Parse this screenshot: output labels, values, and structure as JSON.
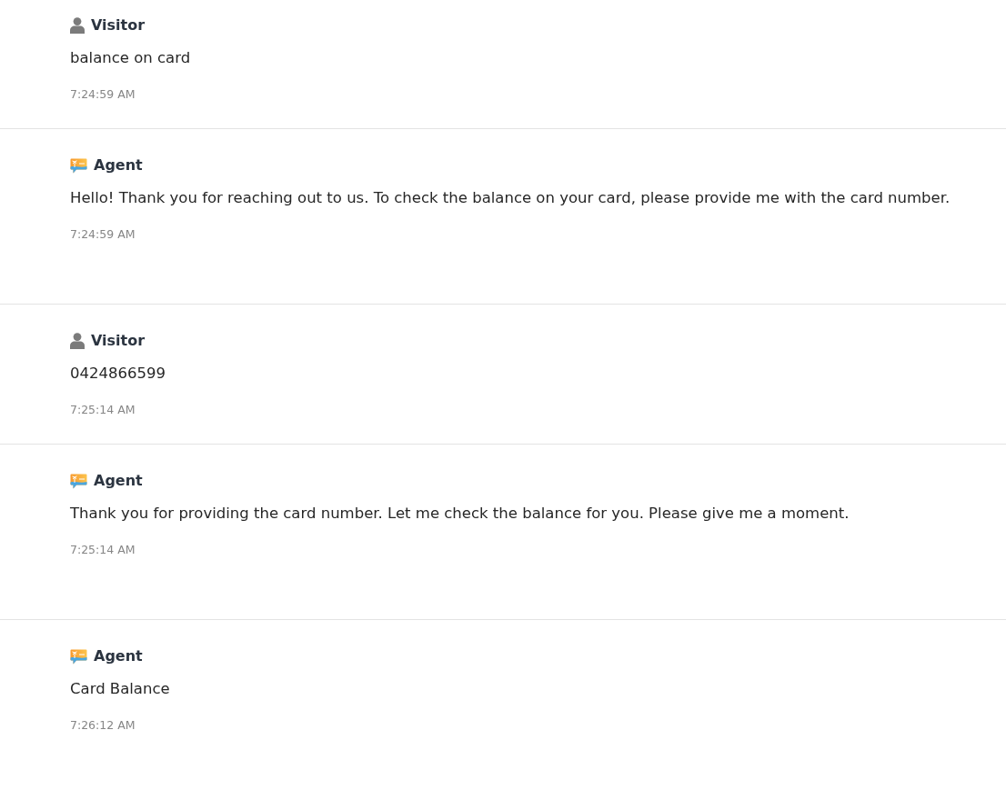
{
  "messages": [
    {
      "kind": "visitor",
      "sender": "Visitor",
      "text": "balance on card",
      "time": "7:24:59 AM"
    },
    {
      "kind": "agent",
      "sender": "Agent",
      "text": "Hello! Thank you for reaching out to us. To check the balance on your card, please provide me with the card number.",
      "time": "7:24:59 AM"
    },
    {
      "kind": "visitor",
      "sender": "Visitor",
      "text": "0424866599",
      "time": "7:25:14 AM"
    },
    {
      "kind": "agent",
      "sender": "Agent",
      "text": "Thank you for providing the card number. Let me check the balance for you. Please give me a moment.",
      "time": "7:25:14 AM"
    },
    {
      "kind": "agent",
      "sender": "Agent",
      "text": "Card Balance",
      "time": "7:26:12 AM"
    }
  ]
}
